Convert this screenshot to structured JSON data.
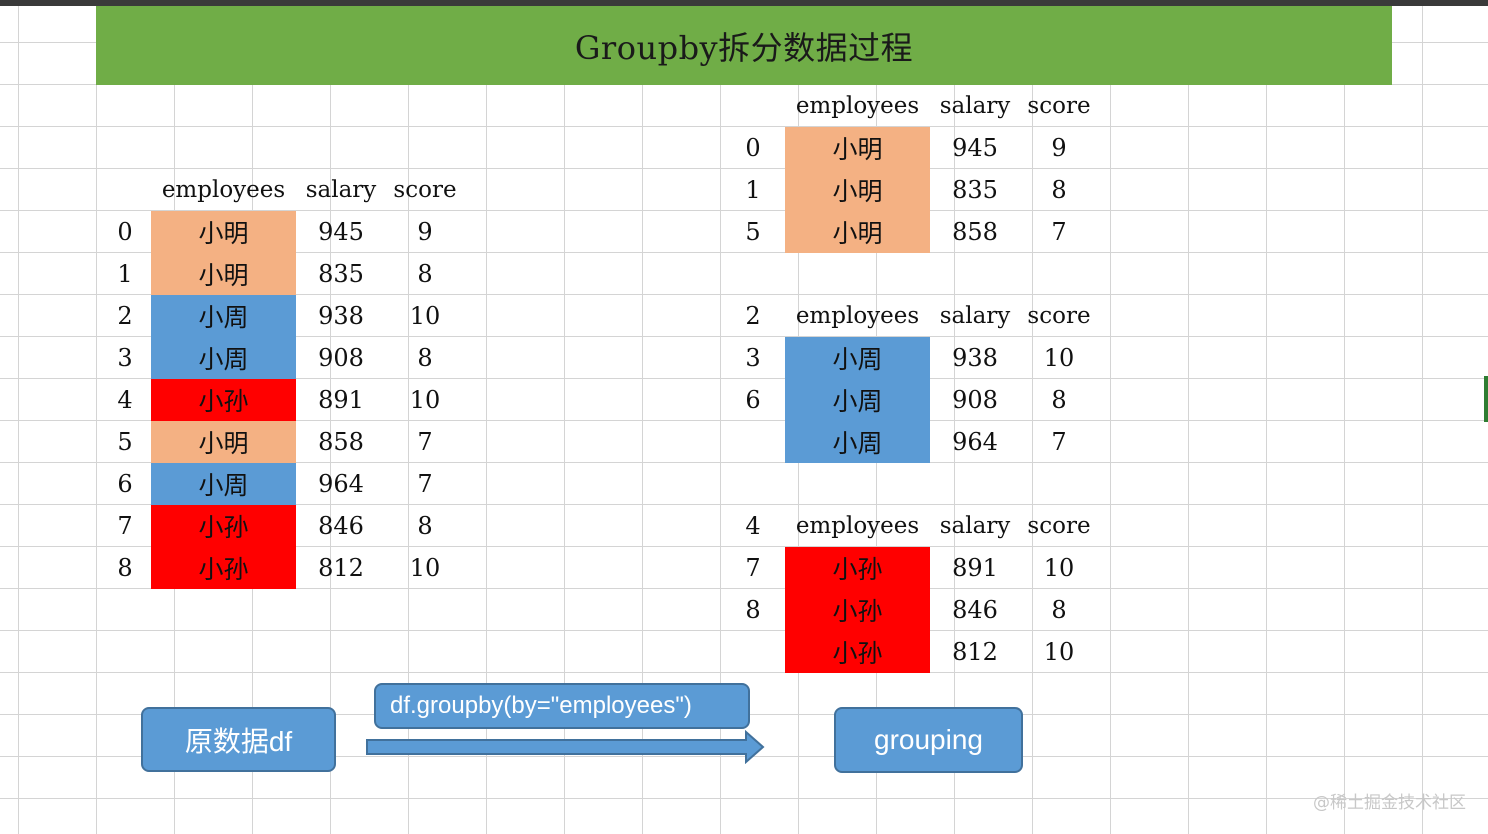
{
  "title": "Groupby拆分数据过程",
  "colors": {
    "title_band": "#70ad47",
    "小明": "#f4b183",
    "小周": "#5b9bd5",
    "小孙": "#ff0000",
    "callout": "#5b9bd5"
  },
  "headers": [
    "employees",
    "salary",
    "score"
  ],
  "source_table": {
    "rows": [
      {
        "idx": "0",
        "employees": "小明",
        "salary": "945",
        "score": "9"
      },
      {
        "idx": "1",
        "employees": "小明",
        "salary": "835",
        "score": "8"
      },
      {
        "idx": "2",
        "employees": "小周",
        "salary": "938",
        "score": "10"
      },
      {
        "idx": "3",
        "employees": "小周",
        "salary": "908",
        "score": "8"
      },
      {
        "idx": "4",
        "employees": "小孙",
        "salary": "891",
        "score": "10"
      },
      {
        "idx": "5",
        "employees": "小明",
        "salary": "858",
        "score": "7"
      },
      {
        "idx": "6",
        "employees": "小周",
        "salary": "964",
        "score": "7"
      },
      {
        "idx": "7",
        "employees": "小孙",
        "salary": "846",
        "score": "8"
      },
      {
        "idx": "8",
        "employees": "小孙",
        "salary": "812",
        "score": "10"
      }
    ]
  },
  "groups": [
    {
      "index_labels": [
        "0",
        "1",
        "5"
      ],
      "rows": [
        {
          "employees": "小明",
          "salary": "945",
          "score": "9"
        },
        {
          "employees": "小明",
          "salary": "835",
          "score": "8"
        },
        {
          "employees": "小明",
          "salary": "858",
          "score": "7"
        }
      ]
    },
    {
      "index_labels": [
        "2",
        "3",
        "6"
      ],
      "rows": [
        {
          "employees": "小周",
          "salary": "938",
          "score": "10"
        },
        {
          "employees": "小周",
          "salary": "908",
          "score": "8"
        },
        {
          "employees": "小周",
          "salary": "964",
          "score": "7"
        }
      ]
    },
    {
      "index_labels": [
        "4",
        "7",
        "8"
      ],
      "rows": [
        {
          "employees": "小孙",
          "salary": "891",
          "score": "10"
        },
        {
          "employees": "小孙",
          "salary": "846",
          "score": "8"
        },
        {
          "employees": "小孙",
          "salary": "812",
          "score": "10"
        }
      ]
    }
  ],
  "callouts": {
    "source": "原数据df",
    "operation": "df.groupby(by=\"employees\")",
    "result": "grouping"
  },
  "watermark": "@稀土掘金技术社区"
}
